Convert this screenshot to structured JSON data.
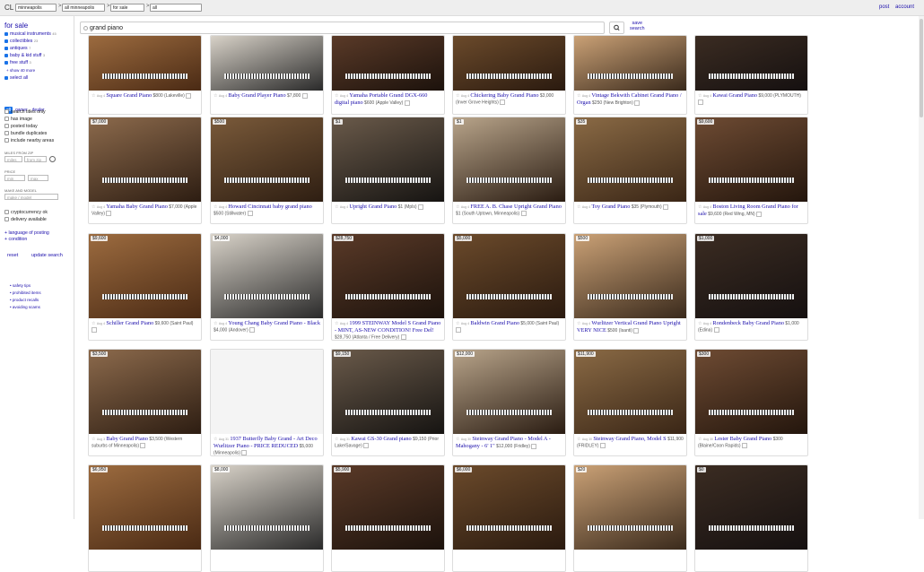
{
  "topbar": {
    "logo": "CL",
    "region": "minneapolis",
    "area": "all minneapolis",
    "category": "for sale",
    "subcategory": "all",
    "post": "post",
    "account": "account"
  },
  "sidebar": {
    "title": "for sale",
    "categories": [
      {
        "label": "musical instruments",
        "count": "45"
      },
      {
        "label": "collectibles",
        "count": "23"
      },
      {
        "label": "antiques",
        "count": "7"
      },
      {
        "label": "baby & kid stuff",
        "count": "3"
      },
      {
        "label": "free stuff",
        "count": "3"
      }
    ],
    "show_more": "show 40 more",
    "select_all": "select all",
    "seller_toggle": [
      "all",
      "owner",
      "dealer"
    ],
    "options": [
      "search titles only",
      "has image",
      "posted today",
      "bundle duplicates",
      "include nearby areas"
    ],
    "miles_label": "MILES FROM ZIP",
    "miles_placeholder": "miles",
    "zip_placeholder": "from zip",
    "price_label": "PRICE",
    "min_placeholder": "min",
    "max_placeholder": "max",
    "make_label": "MAKE AND MODEL",
    "make_placeholder": "make / model",
    "extra_options": [
      "cryptocurrency ok",
      "delivery available"
    ],
    "language_link": "language of posting",
    "condition_link": "condition",
    "reset": "reset",
    "update": "update search",
    "footer_links": [
      "safety tips",
      "prohibited items",
      "product recalls",
      "avoiding scams"
    ]
  },
  "search": {
    "value": "grand piano",
    "save_label_1": "save",
    "save_label_2": "search"
  },
  "colors": {
    "link": "#1a0dab",
    "accent": "#1a73e8"
  },
  "listings": [
    {
      "price": "",
      "title": "Square Grand Piano",
      "amount": "$800",
      "loc": "(Lakeville)",
      "day": "Aug 4"
    },
    {
      "price": "",
      "title": "Baby Grand Player Piano",
      "amount": "$7,800",
      "loc": "",
      "day": "Aug 4"
    },
    {
      "price": "",
      "title": "Yamaha Portable Grand DGX-660 digital piano",
      "amount": "$600",
      "loc": "(Apple Valley)",
      "day": "Aug 4"
    },
    {
      "price": "",
      "title": "Chickering Baby Grand Piano",
      "amount": "$3,000",
      "loc": "(Inver Grove Heights)",
      "day": "Aug 4"
    },
    {
      "price": "",
      "title": "Vintage Bekwith Cabinet Grand Piano / Organ",
      "amount": "$250",
      "loc": "(New Brighton)",
      "day": "Aug 4"
    },
    {
      "price": "",
      "title": "Kawai Grand Piano",
      "amount": "$9,000",
      "loc": "(PLYMOUTH)",
      "day": "Aug 4"
    },
    {
      "price": "$7,000",
      "title": "Yamaha Baby Grand Piano",
      "amount": "$7,000",
      "loc": "(Apple Valley)",
      "day": "Aug 4"
    },
    {
      "price": "$500",
      "title": "Howard Cincinnati baby grand piano",
      "amount": "$500",
      "loc": "(Stillwater)",
      "day": "Aug 4"
    },
    {
      "price": "$1",
      "title": "Upright Grand Piano",
      "amount": "$1",
      "loc": "(Mpls)",
      "day": "Aug 4"
    },
    {
      "price": "$1",
      "title": "FREE A. B. Chase Upright Grand Piano",
      "amount": "$1",
      "loc": "(South Uptown, Minneapolis)",
      "day": "Aug 4"
    },
    {
      "price": "$35",
      "title": "Toy Grand Piano",
      "amount": "$35",
      "loc": "(Plymouth)",
      "day": "Aug 4"
    },
    {
      "price": "$9,600",
      "title": "Boston Living Room Grand Piano for sale",
      "amount": "$9,600",
      "loc": "(Red Wing, MN)",
      "day": "Aug 4"
    },
    {
      "price": "$9,600",
      "title": "Schiller Grand Piano",
      "amount": "$9,600",
      "loc": "(Saint Paul)",
      "day": "Aug 4"
    },
    {
      "price": "$4,000",
      "title": "Young Chang Baby Grand Piano - Black",
      "amount": "$4,000",
      "loc": "(Andover)",
      "day": "Aug 4"
    },
    {
      "price": "$28,750",
      "title": "1999 STEINWAY Model S Grand Piano - MINT, AS-NEW CONDITION! Free Del!",
      "amount": "$28,750",
      "loc": "(Atlanta / Free Delivery)",
      "day": "Aug 4"
    },
    {
      "price": "$5,000",
      "title": "Baldwin Grand Piano",
      "amount": "$5,000",
      "loc": "(Saint Paul)",
      "day": "Aug 4"
    },
    {
      "price": "$500",
      "title": "Wurlitzer Vertical Grand Piano Upright VERY NICE",
      "amount": "$500",
      "loc": "(Isanti)",
      "day": "Aug 4"
    },
    {
      "price": "$1,000",
      "title": "Rondenbeck Baby Grand Piano",
      "amount": "$1,000",
      "loc": "(Edina)",
      "day": "Aug 4"
    },
    {
      "price": "$3,500",
      "title": "Baby Grand Piano",
      "amount": "$3,500",
      "loc": "(Western suburbs of Minneapolis)",
      "day": "Aug 3"
    },
    {
      "price": "",
      "title": "1937 Butterfly Baby Grand - Art Deco Wurlitzer Piano - PRICE REDUCED",
      "amount": "$5,000",
      "loc": "(Minneapolis)",
      "day": "Aug 31"
    },
    {
      "price": "$9,150",
      "title": "Kawai GS-30 Grand piano",
      "amount": "$9,150",
      "loc": "(Prior Lake/Savage)",
      "day": "Aug 31"
    },
    {
      "price": "$12,000",
      "title": "Steinway Grand Piano - Model A - Mahogany - 6' 1\"",
      "amount": "$12,000",
      "loc": "(Fridley)",
      "day": "Aug 30"
    },
    {
      "price": "$11,900",
      "title": "Steinway Grand Piano, Model S",
      "amount": "$11,900",
      "loc": "(FRIDLEY)",
      "day": "Aug 30"
    },
    {
      "price": "$300",
      "title": "Lester Baby Grand Piano",
      "amount": "$300",
      "loc": "(Blaine/Coon Rapids)",
      "day": "Aug 30"
    },
    {
      "price": "$6,950",
      "title": "",
      "amount": "",
      "loc": "",
      "day": ""
    },
    {
      "price": "$8,000",
      "title": "",
      "amount": "",
      "loc": "",
      "day": ""
    },
    {
      "price": "$5,900",
      "title": "",
      "amount": "",
      "loc": "",
      "day": ""
    },
    {
      "price": "$6,000",
      "title": "",
      "amount": "",
      "loc": "",
      "day": ""
    },
    {
      "price": "$20",
      "title": "",
      "amount": "",
      "loc": "",
      "day": ""
    },
    {
      "price": "$0",
      "title": "",
      "amount": "",
      "loc": "",
      "day": ""
    }
  ]
}
